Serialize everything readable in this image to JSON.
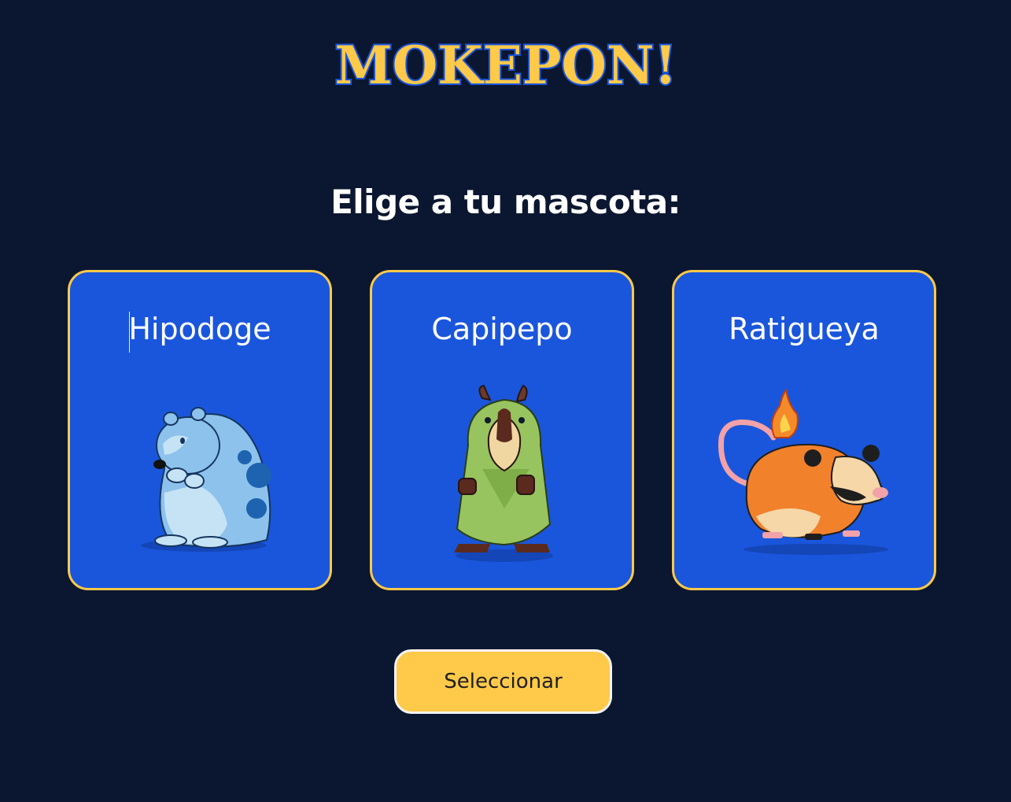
{
  "header": {
    "logo_text": "MOKEPON!"
  },
  "main": {
    "subtitle": "Elige a tu mascota:",
    "pets": [
      {
        "name": "Hipodoge"
      },
      {
        "name": "Capipepo"
      },
      {
        "name": "Ratigueya"
      }
    ],
    "select_button": "Seleccionar"
  },
  "colors": {
    "background": "#0b1730",
    "card": "#1a56db",
    "card_border": "#ffc94a",
    "button": "#ffc94a"
  }
}
